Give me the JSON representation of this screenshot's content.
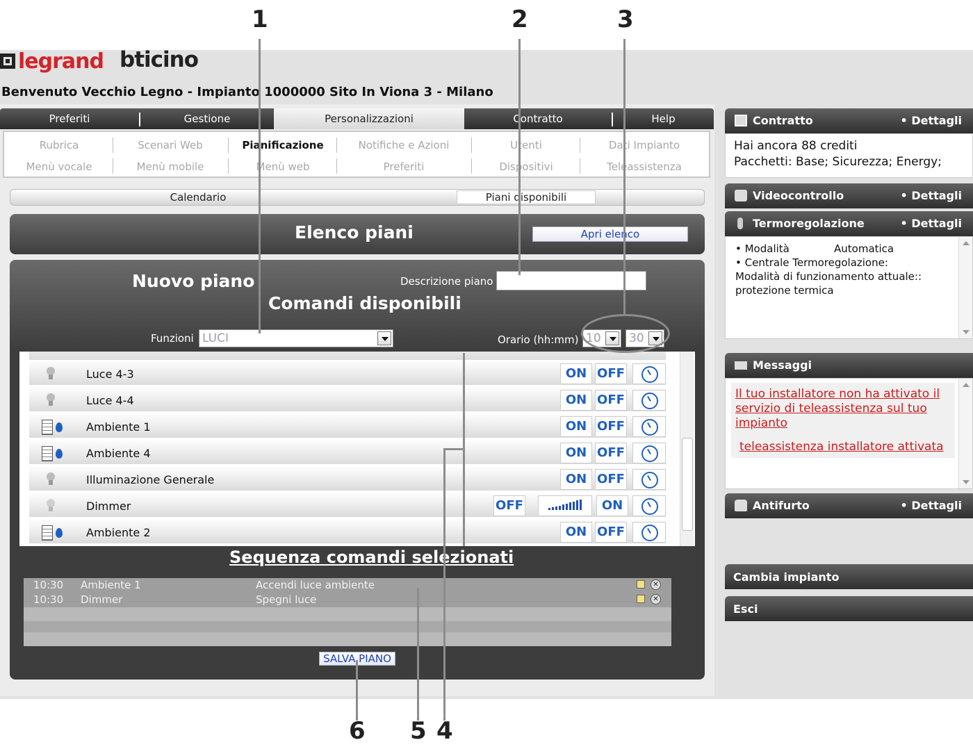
{
  "brand": {
    "logo1": "legrand",
    "logo2": "bticino"
  },
  "welcome": "Benvenuto Vecchio Legno - Impianto 1000000 Sito In Viona 3 - Milano",
  "main_nav": {
    "tabs": [
      "Preferiti",
      "Gestione",
      "Personalizzazioni",
      "Contratto",
      "Help"
    ],
    "active": "Personalizzazioni"
  },
  "sub_menu": {
    "row1": [
      "Rubrica",
      "Scenari Web",
      "Pianificazione",
      "Notifiche e Azioni",
      "Utenti",
      "Dati Impianto"
    ],
    "row2": [
      "Menù vocale",
      "Menù mobile",
      "Menù web",
      "Preferiti",
      "Dispositivi",
      "Teleassistenza"
    ],
    "active": "Pianificazione"
  },
  "calendar_tabs": {
    "calendario": "Calendario",
    "piani": "Piani disponibili"
  },
  "elenco": {
    "title": "Elenco piani",
    "button": "Apri elenco"
  },
  "nuovo": {
    "title": "Nuovo piano",
    "descr_label": "Descrizione piano",
    "descr_value": "",
    "comandi_title": "Comandi disponibili",
    "funzioni_label": "Funzioni",
    "funzioni_value": "LUCI",
    "orario_label": "Orario (hh:mm)",
    "hour": "10",
    "minute": "30"
  },
  "commands": [
    {
      "name": "Luce 4-3",
      "icon": "bulb-icon",
      "on": "ON",
      "off": "OFF"
    },
    {
      "name": "Luce 4-4",
      "icon": "bulb-icon",
      "on": "ON",
      "off": "OFF"
    },
    {
      "name": "Ambiente 1",
      "icon": "ambient-icon",
      "on": "ON",
      "off": "OFF"
    },
    {
      "name": "Ambiente 4",
      "icon": "ambient-icon",
      "on": "ON",
      "off": "OFF"
    },
    {
      "name": "Illuminazione Generale",
      "icon": "bulb-icon",
      "on": "ON",
      "off": "OFF"
    },
    {
      "name": "Dimmer",
      "icon": "dimmer-icon",
      "on": "ON",
      "off": "OFF"
    },
    {
      "name": "Ambiente 2",
      "icon": "ambient-icon",
      "on": "ON",
      "off": "OFF"
    }
  ],
  "sequence": {
    "title": "Sequenza comandi selezionati",
    "rows": [
      {
        "time": "10:30",
        "name": "Ambiente 1",
        "action": "Accendi luce ambiente"
      },
      {
        "time": "10:30",
        "name": "Dimmer",
        "action": "Spegni luce"
      }
    ],
    "save_label": "SALVA PIANO"
  },
  "right": {
    "contratto": {
      "title": "Contratto",
      "details": "• Dettagli",
      "line1": "Hai ancora 88 crediti",
      "line2": "Pacchetti: Base; Sicurezza; Energy;"
    },
    "video": {
      "title": "Videocontrollo",
      "details": "• Dettagli"
    },
    "termo": {
      "title": "Termoregolazione",
      "details": "• Dettagli",
      "l1a": "• Modalità",
      "l1b": "Automatica",
      "l2": "• Centrale Termoregolazione:",
      "l3": "Modalità di funzionamento attuale::",
      "l4": "protezione termica"
    },
    "messaggi": {
      "title": "Messaggi",
      "msg1": "Il tuo installatore non ha attivato il servizio di teleassistenza sul tuo impianto",
      "msg2": "teleassistenza installatore attivata"
    },
    "antifurto": {
      "title": "Antifurto",
      "details": "• Dettagli"
    },
    "cambia": "Cambia impianto",
    "esci": "Esci"
  },
  "callouts": [
    "1",
    "2",
    "3",
    "4",
    "5",
    "6"
  ]
}
